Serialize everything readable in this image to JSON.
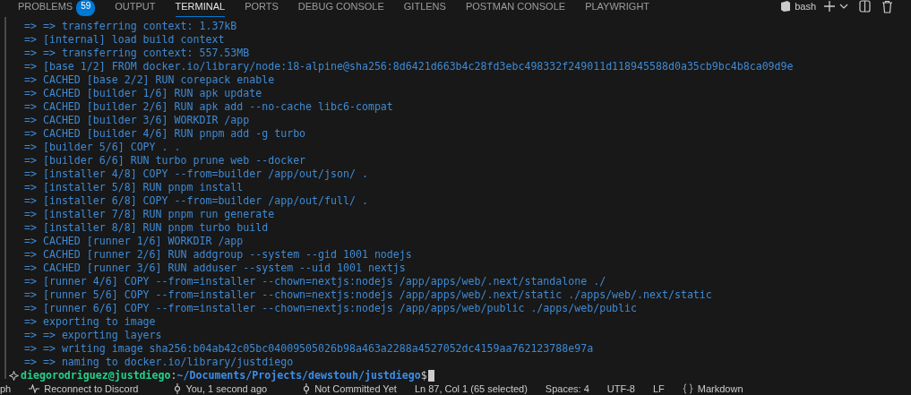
{
  "tabs": [
    {
      "label": "PROBLEMS",
      "badge": "59",
      "selected": false
    },
    {
      "label": "OUTPUT",
      "selected": false
    },
    {
      "label": "TERMINAL",
      "selected": true
    },
    {
      "label": "PORTS",
      "selected": false
    },
    {
      "label": "DEBUG CONSOLE",
      "selected": false
    },
    {
      "label": "GITLENS",
      "selected": false
    },
    {
      "label": "POSTMAN CONSOLE",
      "selected": false
    },
    {
      "label": "PLAYWRIGHT",
      "selected": false
    }
  ],
  "terminal_profile": "bash",
  "lines": [
    "=> => transferring context: 1.37kB",
    "=> [internal] load build context",
    "=> => transferring context: 557.53MB",
    "=> [base 1/2] FROM docker.io/library/node:18-alpine@sha256:8d6421d663b4c28fd3ebc498332f249011d118945588d0a35cb9bc4b8ca09d9e",
    "=> CACHED [base 2/2] RUN corepack enable",
    "=> CACHED [builder 1/6] RUN apk update",
    "=> CACHED [builder 2/6] RUN apk add --no-cache libc6-compat",
    "=> CACHED [builder 3/6] WORKDIR /app",
    "=> CACHED [builder 4/6] RUN pnpm add -g turbo",
    "=> [builder 5/6] COPY . .",
    "=> [builder 6/6] RUN turbo prune web --docker",
    "=> [installer 4/8] COPY --from=builder /app/out/json/ .",
    "=> [installer 5/8] RUN pnpm install",
    "=> [installer 6/8] COPY --from=builder /app/out/full/ .",
    "=> [installer 7/8] RUN pnpm run generate",
    "=> [installer 8/8] RUN pnpm turbo build",
    "=> CACHED [runner 1/6] WORKDIR /app",
    "=> CACHED [runner 2/6] RUN addgroup --system --gid 1001 nodejs",
    "=> CACHED [runner 3/6] RUN adduser --system --uid 1001 nextjs",
    "=> [runner 4/6] COPY --from=installer --chown=nextjs:nodejs /app/apps/web/.next/standalone ./",
    "=> [runner 5/6] COPY --from=installer --chown=nextjs:nodejs /app/apps/web/.next/static ./apps/web/.next/static",
    "=> [runner 6/6] COPY --from=installer --chown=nextjs:nodejs /app/apps/web/public ./apps/web/public",
    "=> exporting to image",
    "=> => exporting layers",
    "=> => writing image sha256:b04ab42c05bc04009505026b98a463a2288a4527052dc4159aa762123788e97a",
    "=> => naming to docker.io/library/justdiego"
  ],
  "prompt": {
    "user": "diegorodriguez@justdiego",
    "separator": ":",
    "path": "~/Documents/Projects/dewstouh/justdiego",
    "symbol": "$"
  },
  "status_bar": [
    {
      "kind": "text",
      "label": "ph"
    },
    {
      "kind": "pulse",
      "label": "Reconnect to Discord"
    },
    {
      "kind": "commit",
      "label": "You, 1 second ago"
    },
    {
      "kind": "commit",
      "label": "Not Committed Yet"
    },
    {
      "kind": "text",
      "label": "Ln 87, Col 1 (65 selected)"
    },
    {
      "kind": "text",
      "label": "Spaces: 4"
    },
    {
      "kind": "text",
      "label": "UTF-8"
    },
    {
      "kind": "text",
      "label": "LF"
    },
    {
      "kind": "braces",
      "label": "Markdown"
    }
  ]
}
